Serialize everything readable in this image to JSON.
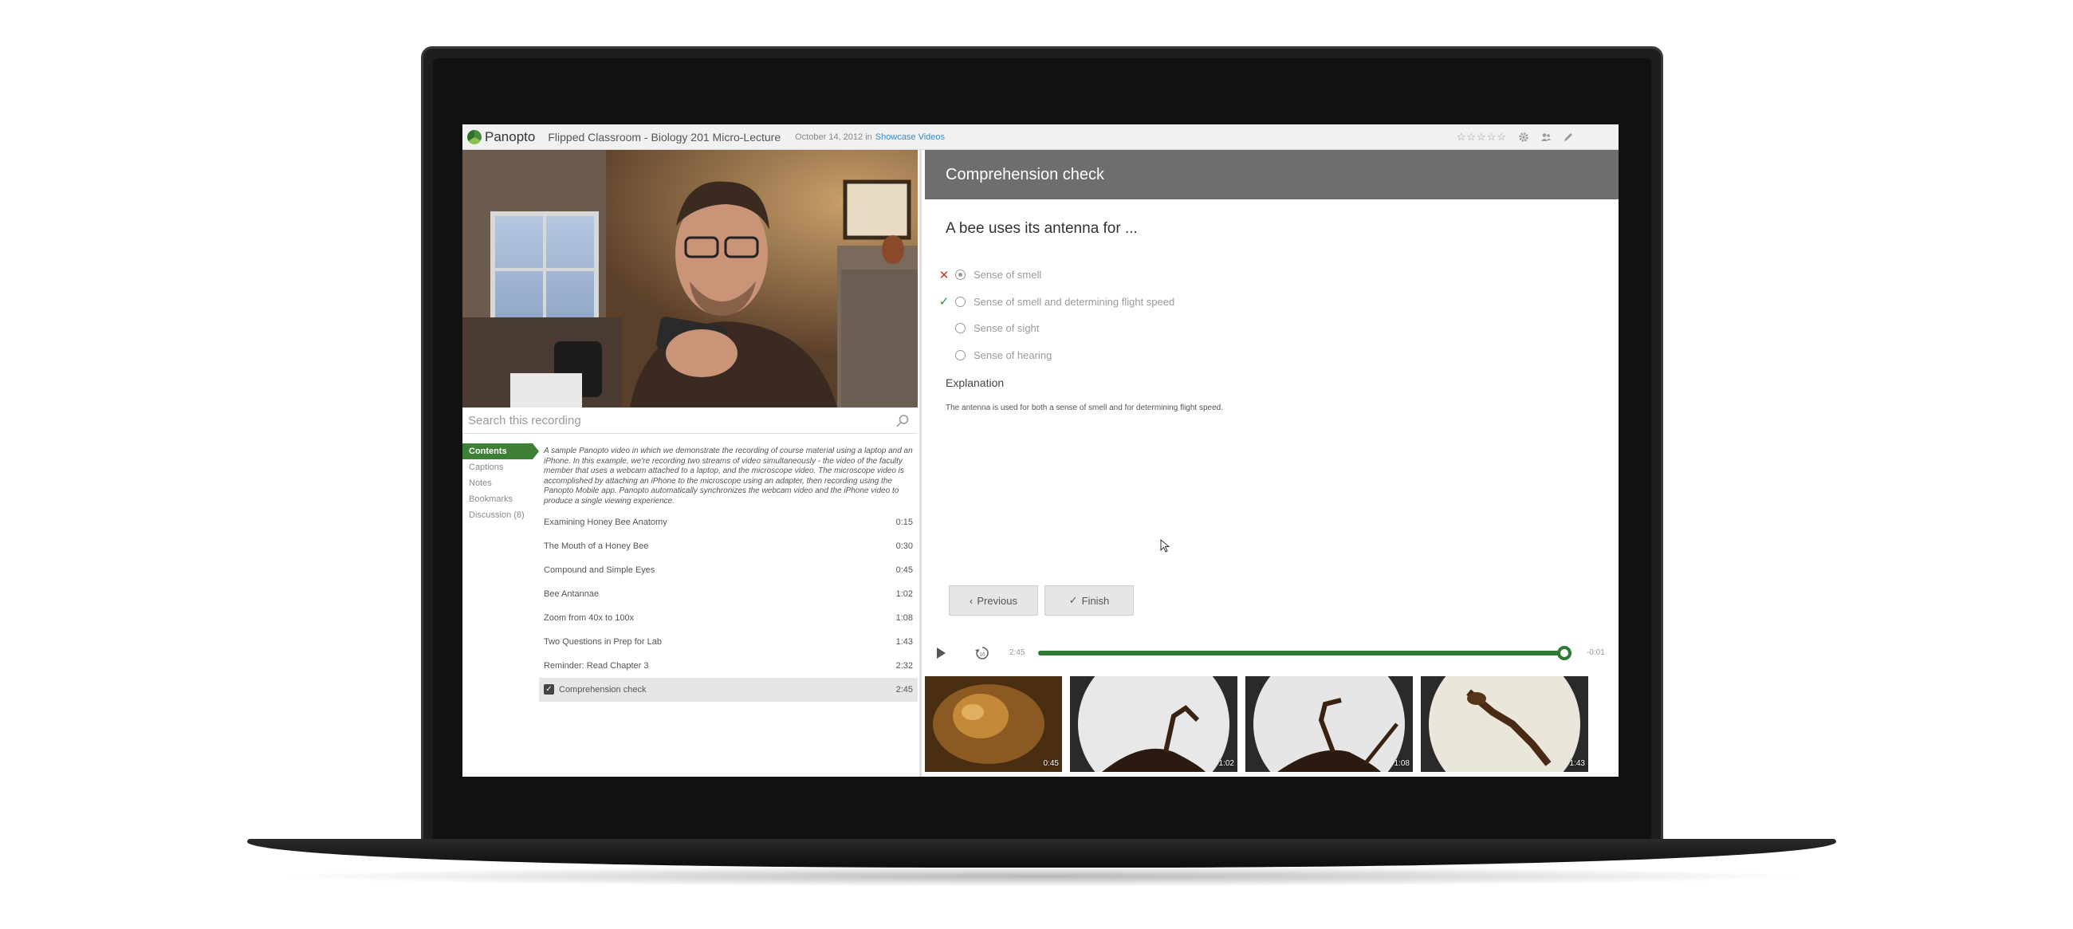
{
  "app": {
    "logo_text": "Panopto",
    "lecture_title": "Flipped Classroom - Biology 201 Micro-Lecture",
    "date_prefix": "October 14, 2012 in",
    "folder_link": "Showcase Videos",
    "rating": "☆☆☆☆☆"
  },
  "search": {
    "placeholder": "Search this recording"
  },
  "sidebar": {
    "items": [
      {
        "label": "Contents",
        "active": true
      },
      {
        "label": "Captions",
        "active": false
      },
      {
        "label": "Notes",
        "active": false
      },
      {
        "label": "Bookmarks",
        "active": false
      },
      {
        "label": "Discussion (8)",
        "active": false
      }
    ]
  },
  "contents": {
    "description": "A sample Panopto video in which we demonstrate the recording of course material using a laptop and an iPhone. In this example, we're recording two streams of video simultaneously - the video of the faculty member that uses a webcam attached to a laptop, and the microscope video. The microscope video is accomplished by attaching an iPhone to the microscope using an adapter, then recording using the Panopto Mobile app. Panopto automatically synchronizes the webcam video and the iPhone video to produce a single viewing experience.",
    "items": [
      {
        "title": "Examining Honey Bee Anatomy",
        "time": "0:15"
      },
      {
        "title": "The Mouth of a Honey Bee",
        "time": "0:30"
      },
      {
        "title": "Compound and Simple Eyes",
        "time": "0:45"
      },
      {
        "title": "Bee Antannae",
        "time": "1:02"
      },
      {
        "title": "Zoom from 40x to 100x",
        "time": "1:08"
      },
      {
        "title": "Two Questions in Prep for Lab",
        "time": "1:43"
      },
      {
        "title": "Reminder: Read Chapter 3",
        "time": "2:32"
      },
      {
        "title": "Comprehension check",
        "time": "2:45"
      }
    ]
  },
  "quiz": {
    "header": "Comprehension check",
    "question": "A bee uses its antenna for ...",
    "answers": [
      {
        "label": "Sense of smell",
        "selected": true,
        "mark": "✕"
      },
      {
        "label": "Sense of smell and determining flight speed",
        "selected": false,
        "mark": "✓"
      },
      {
        "label": "Sense of sight",
        "selected": false,
        "mark": ""
      },
      {
        "label": "Sense of hearing",
        "selected": false,
        "mark": ""
      }
    ],
    "explanation_heading": "Explanation",
    "explanation_text": "The antenna is used for both a sense of smell and for determining flight speed.",
    "previous_label": "Previous",
    "finish_label": "Finish"
  },
  "player": {
    "elapsed": "2:45",
    "remaining": "-0:01",
    "progress": 0.985,
    "accent": "#2f7a36"
  },
  "thumbnails": [
    {
      "time": "0:45"
    },
    {
      "time": "1:02"
    },
    {
      "time": "1:08"
    },
    {
      "time": "1:43"
    }
  ]
}
